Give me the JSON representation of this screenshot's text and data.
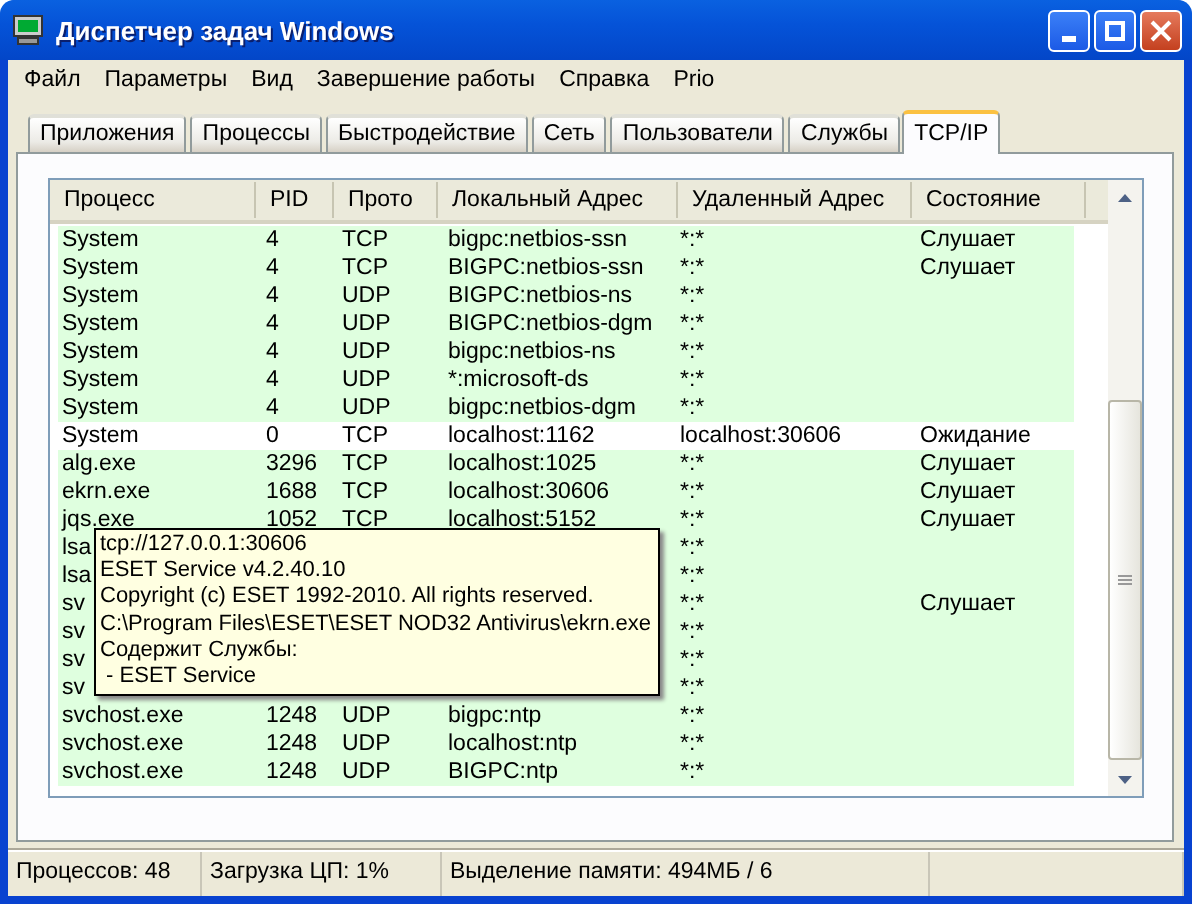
{
  "window": {
    "title": "Диспетчер задач Windows"
  },
  "menu": [
    "Файл",
    "Параметры",
    "Вид",
    "Завершение работы",
    "Справка",
    "Prio"
  ],
  "tabs": [
    {
      "label": "Приложения",
      "selected": false
    },
    {
      "label": "Процессы",
      "selected": false
    },
    {
      "label": "Быстродействие",
      "selected": false
    },
    {
      "label": "Сеть",
      "selected": false
    },
    {
      "label": "Пользователи",
      "selected": false
    },
    {
      "label": "Службы",
      "selected": false
    },
    {
      "label": "TCP/IP",
      "selected": true
    }
  ],
  "table": {
    "columns": [
      "Процесс",
      "PID",
      "Прото",
      "Локальный Адрес",
      "Удаленный Адрес",
      "Состояние"
    ],
    "rows": [
      {
        "process": "System",
        "pid": "4",
        "proto": "TCP",
        "local": "bigpc:netbios-ssn",
        "remote": "*:*",
        "state": "Слушает",
        "highlighted": true
      },
      {
        "process": "System",
        "pid": "4",
        "proto": "TCP",
        "local": "BIGPC:netbios-ssn",
        "remote": "*:*",
        "state": "Слушает",
        "highlighted": true
      },
      {
        "process": "System",
        "pid": "4",
        "proto": "UDP",
        "local": "BIGPC:netbios-ns",
        "remote": "*:*",
        "highlighted": true
      },
      {
        "process": "System",
        "pid": "4",
        "proto": "UDP",
        "local": "BIGPC:netbios-dgm",
        "remote": "*:*",
        "highlighted": true
      },
      {
        "process": "System",
        "pid": "4",
        "proto": "UDP",
        "local": "bigpc:netbios-ns",
        "remote": "*:*",
        "highlighted": true
      },
      {
        "process": "System",
        "pid": "4",
        "proto": "UDP",
        "local": "*:microsoft-ds",
        "remote": "*:*",
        "highlighted": true
      },
      {
        "process": "System",
        "pid": "4",
        "proto": "UDP",
        "local": "bigpc:netbios-dgm",
        "remote": "*:*",
        "highlighted": true
      },
      {
        "process": "System",
        "pid": "0",
        "proto": "TCP",
        "local": "localhost:1162",
        "remote": "localhost:30606",
        "state": "Ожидание",
        "highlighted": false
      },
      {
        "process": "alg.exe",
        "pid": "3296",
        "proto": "TCP",
        "local": "localhost:1025",
        "remote": "*:*",
        "state": "Слушает",
        "highlighted": true
      },
      {
        "process": "ekrn.exe",
        "pid": "1688",
        "proto": "TCP",
        "local": "localhost:30606",
        "remote": "*:*",
        "state": "Слушает",
        "highlighted": true
      },
      {
        "process": "jqs.exe",
        "pid": "1052",
        "proto": "TCP",
        "local": "localhost:5152",
        "remote": "*:*",
        "state": "Слушает",
        "highlighted": true
      },
      {
        "process": "lsa",
        "remote": "*:*",
        "highlighted": true
      },
      {
        "process": "lsa",
        "remote": "*:*",
        "highlighted": true
      },
      {
        "process": "sv",
        "remote": "*:*",
        "state": "Слушает",
        "highlighted": true
      },
      {
        "process": "sv",
        "remote": "*:*",
        "highlighted": true
      },
      {
        "process": "sv",
        "remote": "*:*",
        "highlighted": true
      },
      {
        "process": "sv",
        "remote": "*:*",
        "highlighted": true
      },
      {
        "process": "svchost.exe",
        "pid": "1248",
        "proto": "UDP",
        "local": "bigpc:ntp",
        "remote": "*:*",
        "highlighted": true
      },
      {
        "process": "svchost.exe",
        "pid": "1248",
        "proto": "UDP",
        "local": "localhost:ntp",
        "remote": "*:*",
        "highlighted": true
      },
      {
        "process": "svchost.exe",
        "pid": "1248",
        "proto": "UDP",
        "local": "BIGPC:ntp",
        "remote": "*:*",
        "highlighted": true
      }
    ]
  },
  "tooltip": [
    "tcp://127.0.0.1:30606",
    "ESET Service v4.2.40.10",
    "Copyright (c) ESET 1992-2010. All rights reserved.",
    "C:\\Program Files\\ESET\\ESET NOD32 Antivirus\\ekrn.exe",
    "Содержит Службы:",
    " - ESET Service"
  ],
  "status_bar": [
    "Процессов: 48",
    "Загрузка ЦП: 1%",
    "Выделение памяти: 494МБ / 6"
  ]
}
